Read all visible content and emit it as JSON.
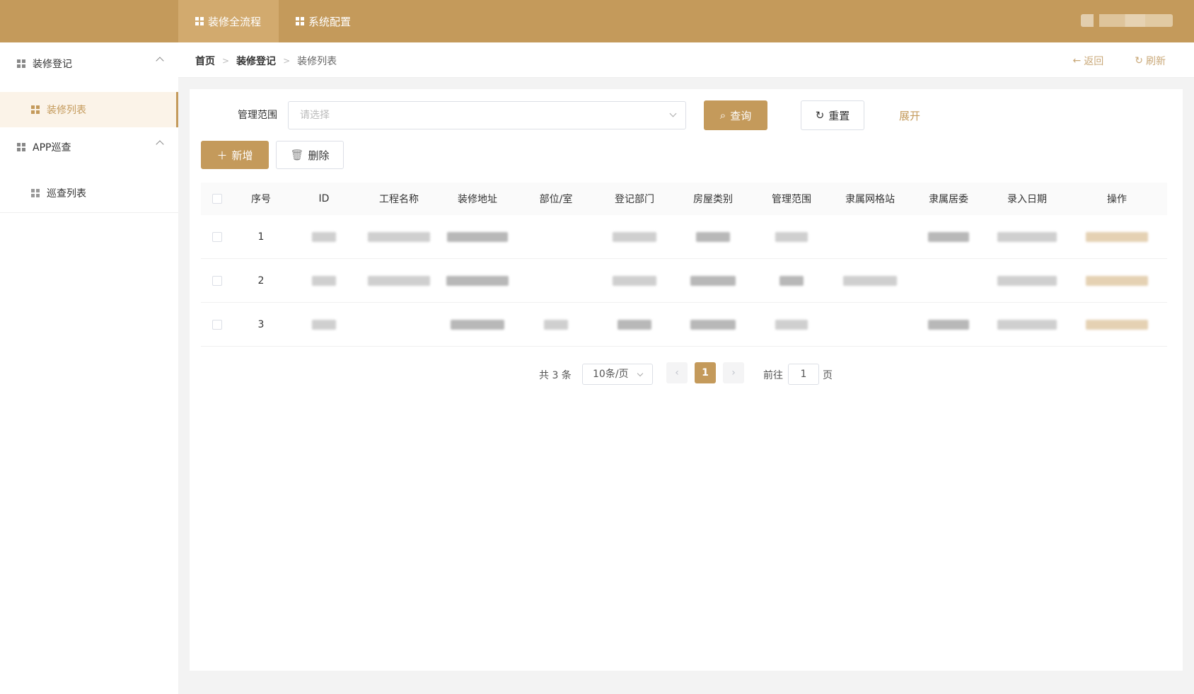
{
  "topbar": {
    "tabs": [
      {
        "label": "装修全流程",
        "active": true
      },
      {
        "label": "系统配置",
        "active": false
      }
    ]
  },
  "sidebar": {
    "groups": [
      {
        "label": "装修登记",
        "items": [
          {
            "label": "装修列表",
            "active": true
          }
        ]
      },
      {
        "label": "APP巡查",
        "items": [
          {
            "label": "巡查列表",
            "active": false
          }
        ]
      }
    ]
  },
  "breadcrumb": {
    "items": [
      "首页",
      "装修登记",
      "装修列表"
    ],
    "back_label": "返回",
    "refresh_label": "刷新"
  },
  "filter": {
    "label": "管理范围",
    "placeholder": "请选择",
    "query_label": "查询",
    "reset_label": "重置",
    "expand_label": "展开"
  },
  "toolbar": {
    "add_label": "新增",
    "delete_label": "删除"
  },
  "table": {
    "columns": [
      "序号",
      "ID",
      "工程名称",
      "装修地址",
      "部位/室",
      "登记部门",
      "房屋类别",
      "管理范围",
      "隶属网格站",
      "隶属居委",
      "录入日期",
      "操作"
    ],
    "rows": [
      {
        "index": "1"
      },
      {
        "index": "2"
      },
      {
        "index": "3"
      }
    ]
  },
  "pagination": {
    "total_text": "共 3 条",
    "page_size": "10条/页",
    "current_page": "1",
    "goto_label": "前往",
    "goto_value": "1",
    "goto_suffix": "页"
  },
  "colors": {
    "primary": "#c49a5b",
    "active_tab": "#d2aa6e",
    "active_menu_bg": "#fbf3e8"
  }
}
